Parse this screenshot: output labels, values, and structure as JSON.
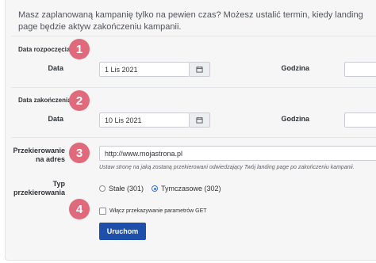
{
  "intro_text": "Masz zaplanowaną kampanię tylko na pewien czas? Możesz ustalić termin, kiedy landing page będzie aktyw zakończeniu kampanii.",
  "start": {
    "section_title": "Data rozpoczęcia",
    "badge": "1",
    "date_label": "Data",
    "date_value": "1 Lis 2021",
    "time_label": "Godzina"
  },
  "end": {
    "section_title": "Data zakończenia",
    "badge": "2",
    "date_label": "Data",
    "date_value": "10 Lis 2021",
    "time_label": "Godzina"
  },
  "redirect": {
    "label_line1": "Przekierowanie",
    "label_line2": "na adres",
    "badge": "3",
    "url_value": "http://www.mojastrona.pl",
    "hint": "Ustaw stronę na jaką zostaną przekierowani odwiedzający Twój landing page po zakończeniu kampanii."
  },
  "type": {
    "label_line1": "Typ",
    "label_line2": "przekierowania",
    "badge": "4",
    "options": [
      {
        "label": "Stałe (301)",
        "checked": false
      },
      {
        "label": "Tymczasowe (302)",
        "checked": true
      }
    ]
  },
  "pass_get_params": {
    "label": "Włącz przekazywanie parametrów GET",
    "checked": false
  },
  "submit_label": "Uruchom",
  "colors": {
    "badge": "#e06a7c",
    "button": "#1e4faa",
    "panel": "#f6f6f7"
  }
}
